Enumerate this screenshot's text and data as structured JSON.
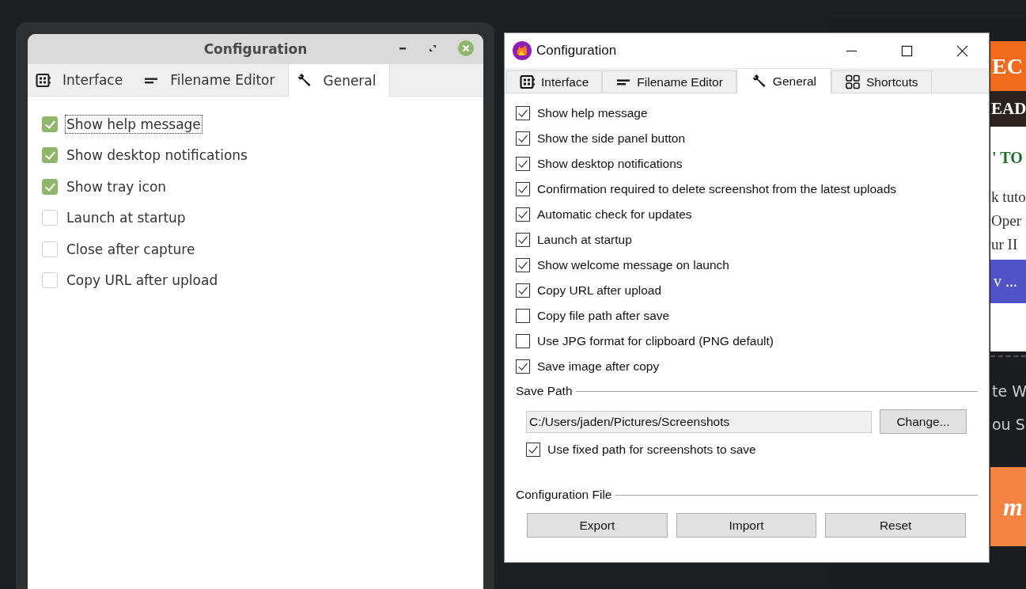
{
  "left_window": {
    "title": "Configuration",
    "tabs": [
      {
        "label": "Interface",
        "selected": false
      },
      {
        "label": "Filename Editor",
        "selected": false
      },
      {
        "label": "General",
        "selected": true
      }
    ],
    "options": [
      {
        "label": "Show help message",
        "checked": true,
        "focused": true
      },
      {
        "label": "Show desktop notifications",
        "checked": true,
        "focused": false
      },
      {
        "label": "Show tray icon",
        "checked": true,
        "focused": false
      },
      {
        "label": "Launch at startup",
        "checked": false,
        "focused": false
      },
      {
        "label": "Close after capture",
        "checked": false,
        "focused": false
      },
      {
        "label": "Copy URL after upload",
        "checked": false,
        "focused": false
      }
    ]
  },
  "right_window": {
    "title": "Configuration",
    "tabs": [
      {
        "label": "Interface",
        "selected": false
      },
      {
        "label": "Filename Editor",
        "selected": false
      },
      {
        "label": "General",
        "selected": true
      },
      {
        "label": "Shortcuts",
        "selected": false
      }
    ],
    "options": [
      {
        "label": "Show help message",
        "checked": true
      },
      {
        "label": "Show the side panel button",
        "checked": true
      },
      {
        "label": "Show desktop notifications",
        "checked": true
      },
      {
        "label": "Confirmation required to delete screenshot from the latest uploads",
        "checked": true
      },
      {
        "label": "Automatic check for updates",
        "checked": true
      },
      {
        "label": "Launch at startup",
        "checked": true
      },
      {
        "label": "Show welcome message on launch",
        "checked": true
      },
      {
        "label": "Copy URL after upload",
        "checked": true
      },
      {
        "label": "Copy file path after save",
        "checked": false
      },
      {
        "label": "Use JPG format for clipboard (PNG default)",
        "checked": false
      },
      {
        "label": "Save image after copy",
        "checked": true
      }
    ],
    "save_path": {
      "heading": "Save Path",
      "value": "C:/Users/jaden/Pictures/Screenshots",
      "button": "Change...",
      "fixed_path": {
        "label": "Use fixed path for screenshots to save",
        "checked": true
      }
    },
    "config_file": {
      "heading": "Configuration File",
      "buttons": [
        "Export",
        "Import",
        "Reset"
      ]
    }
  },
  "background_page": {
    "blocks": [
      {
        "kind": "banner",
        "text": "EC"
      },
      {
        "kind": "strip",
        "text": "EAD"
      },
      {
        "kind": "card",
        "texts": [
          "' TO",
          "k tuto",
          "Oper",
          "ur II"
        ],
        "button": "v ..."
      },
      {
        "kind": "dark",
        "texts": [
          "te W",
          "ou S"
        ]
      },
      {
        "kind": "promo",
        "text": "m"
      }
    ]
  }
}
